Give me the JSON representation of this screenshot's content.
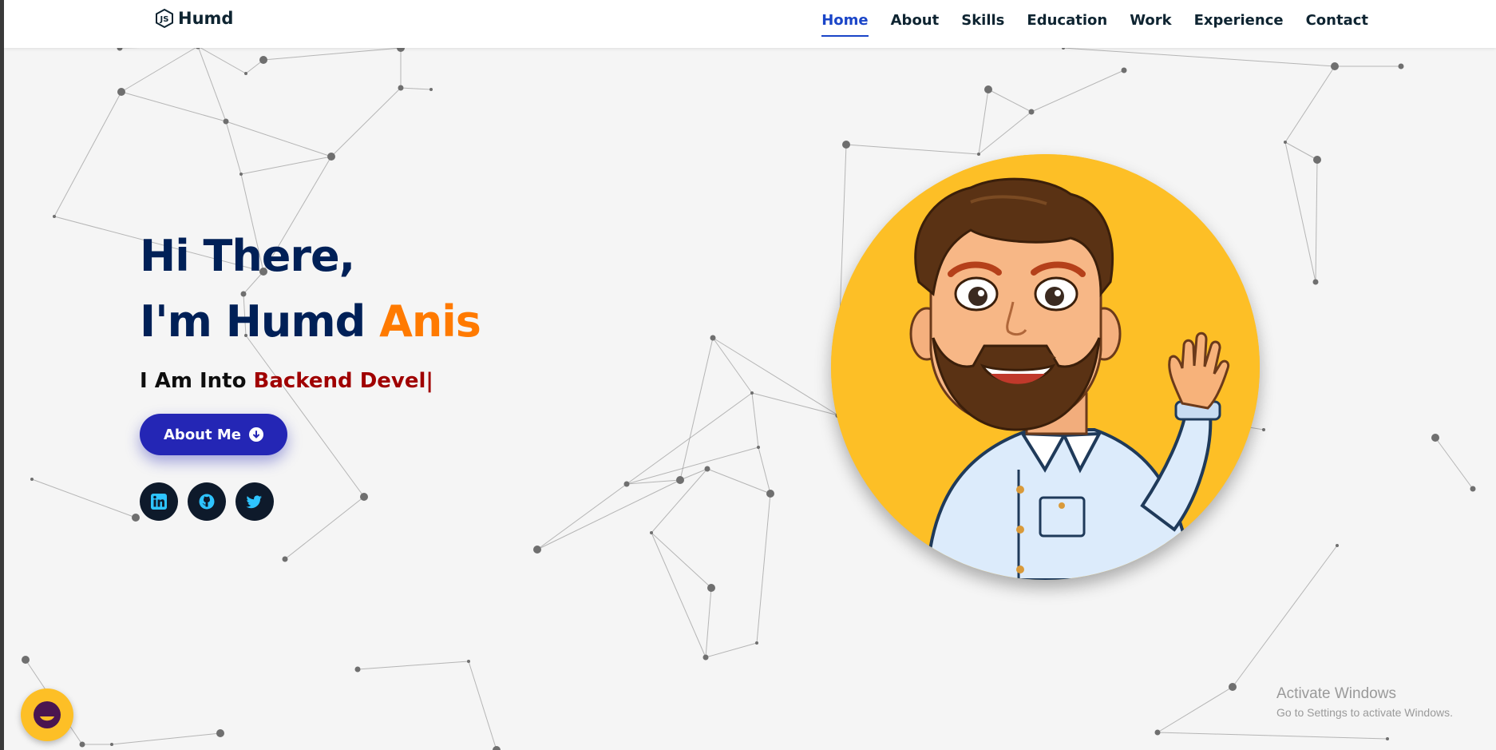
{
  "header": {
    "brand": "Humd",
    "nav": [
      "Home",
      "About",
      "Skills",
      "Education",
      "Work",
      "Experience",
      "Contact"
    ],
    "active_nav": "Home"
  },
  "hero": {
    "greeting_line1": "Hi There,",
    "greeting_line2_prefix": "I'm Humd ",
    "greeting_line2_accent": "Anis",
    "tagline_prefix": "I Am Into ",
    "tagline_typed": "Backend Devel|",
    "about_button": "About Me",
    "socials": [
      {
        "icon": "linkedin-icon"
      },
      {
        "icon": "github-icon"
      },
      {
        "icon": "twitter-icon"
      }
    ]
  },
  "watermark": {
    "title": "Activate Windows",
    "subtitle": "Go to Settings to activate Windows."
  },
  "colors": {
    "navy": "#002057",
    "accent_orange": "#ff7a00",
    "typed_red": "#a00000",
    "button_blue": "#2426b5",
    "avatar_bg": "#fdbf26",
    "nav_active": "#1a45c8"
  }
}
